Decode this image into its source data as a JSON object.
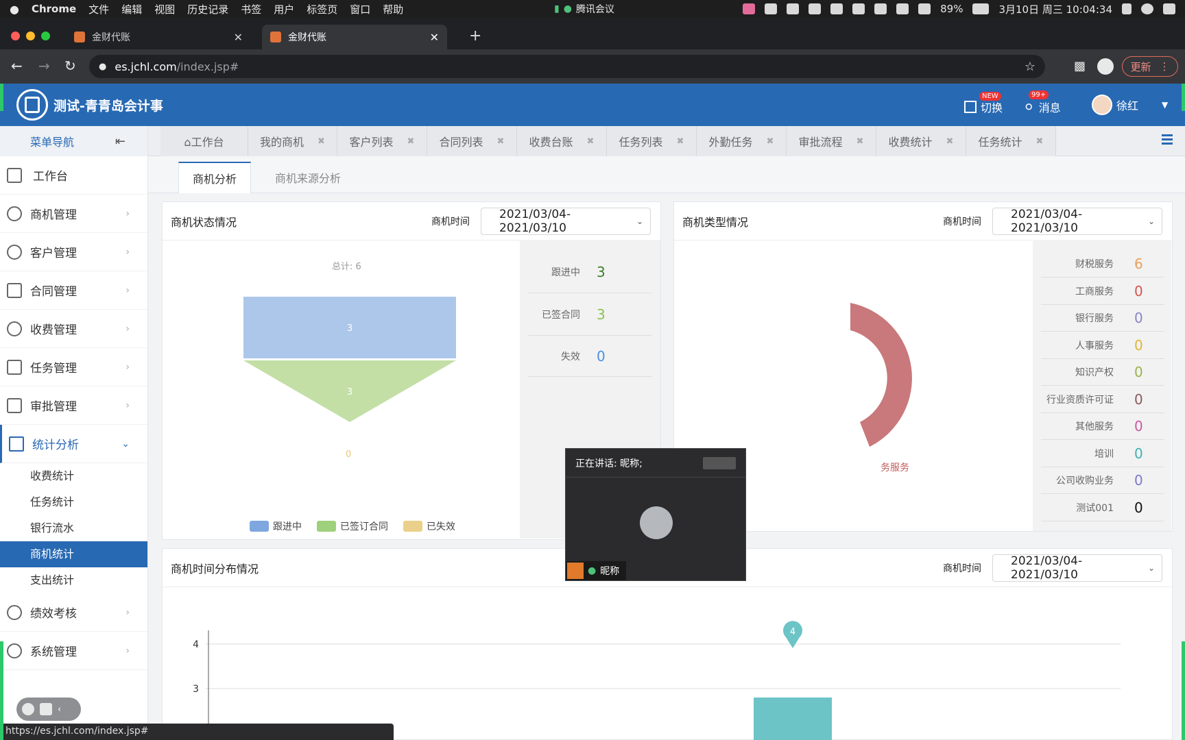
{
  "mac_menubar": {
    "apple_icon": "apple-icon",
    "app": "Chrome",
    "items": [
      "文件",
      "编辑",
      "视图",
      "历史记录",
      "书签",
      "用户",
      "标签页",
      "窗口",
      "帮助"
    ],
    "meeting": "腾讯会议",
    "battery": "89%",
    "datetime": "3月10日 周三  10:04:34"
  },
  "browser": {
    "tabs": [
      {
        "title": "金财代账",
        "active": false
      },
      {
        "title": "金财代账",
        "active": true
      }
    ],
    "url_host": "es.jchl.com",
    "url_path": "/index.jsp#",
    "update_label": "更新",
    "status_url": "https://es.jchl.com/index.jsp#"
  },
  "header": {
    "title": "测试-青青岛会计事",
    "switch_label": "切换",
    "switch_badge": "NEW",
    "msg_label": "消息",
    "msg_badge": "99+",
    "user_name": "徐红"
  },
  "sidebar": {
    "head_label": "菜单导航",
    "items": [
      {
        "label": "工作台",
        "icon": "home-icon"
      },
      {
        "label": "商机管理",
        "icon": "dollar-icon"
      },
      {
        "label": "客户管理",
        "icon": "user-icon"
      },
      {
        "label": "合同管理",
        "icon": "contract-icon"
      },
      {
        "label": "收费管理",
        "icon": "yen-icon"
      },
      {
        "label": "任务管理",
        "icon": "task-icon"
      },
      {
        "label": "审批管理",
        "icon": "approval-icon"
      },
      {
        "label": "统计分析",
        "icon": "chart-icon"
      }
    ],
    "sub_items": [
      "收费统计",
      "任务统计",
      "银行流水",
      "商机统计",
      "支出统计"
    ],
    "items_after": [
      {
        "label": "绩效考核",
        "icon": "performance-icon"
      },
      {
        "label": "系统管理",
        "icon": "gear-icon"
      }
    ]
  },
  "page_tabs": [
    "工作台",
    "我的商机",
    "客户列表",
    "合同列表",
    "收费台账",
    "任务列表",
    "外勤任务",
    "审批流程",
    "收费统计",
    "任务统计"
  ],
  "sub_tabs": [
    "商机分析",
    "商机来源分析"
  ],
  "status_panel": {
    "title": "商机状态情况",
    "date_label": "商机时间",
    "date_value": "2021/03/04-2021/03/10",
    "total_label": "总计: 6",
    "funnel_values": [
      "3",
      "3",
      "0"
    ],
    "stats": [
      {
        "label": "跟进中",
        "value": "3",
        "color": "#3f7f2b"
      },
      {
        "label": "已签合同",
        "value": "3",
        "color": "#8cc152"
      },
      {
        "label": "失效",
        "value": "0",
        "color": "#4a90e2"
      }
    ],
    "legend": [
      {
        "label": "跟进中",
        "color": "#7fa7df"
      },
      {
        "label": "已签订合同",
        "color": "#9fd07c"
      },
      {
        "label": "已失效",
        "color": "#ead08a"
      }
    ]
  },
  "type_panel": {
    "title": "商机类型情况",
    "date_label": "商机时间",
    "date_value": "2021/03/04-2021/03/10",
    "pie_label": "务服务",
    "stats": [
      {
        "label": "财税服务",
        "value": "6",
        "color": "#e8a05c"
      },
      {
        "label": "工商服务",
        "value": "0",
        "color": "#d9534f"
      },
      {
        "label": "银行服务",
        "value": "0",
        "color": "#8a84c9"
      },
      {
        "label": "人事服务",
        "value": "0",
        "color": "#e0b63a"
      },
      {
        "label": "知识产权",
        "value": "0",
        "color": "#9ab34a"
      },
      {
        "label": "行业资质许可证",
        "value": "0",
        "color": "#8a5a5a"
      },
      {
        "label": "其他服务",
        "value": "0",
        "color": "#c75aa0"
      },
      {
        "label": "培训",
        "value": "0",
        "color": "#3fb3b0"
      },
      {
        "label": "公司收购业务",
        "value": "0",
        "color": "#7a7ad0"
      },
      {
        "label": "测试001",
        "value": "0",
        "color": "#111111"
      }
    ]
  },
  "time_panel": {
    "title": "商机时间分布情况",
    "date_label": "商机时间",
    "date_value": "2021/03/04-2021/03/10"
  },
  "video": {
    "speaking": "正在讲话: 昵称;",
    "name": "昵称"
  },
  "chart_data": {
    "type": "bar",
    "title": "商机时间分布情况",
    "xlabel": "",
    "ylabel": "",
    "y_ticks": [
      3,
      4
    ],
    "ylim": [
      0,
      4
    ],
    "bars": [
      {
        "value": 4,
        "marker_label": "4"
      }
    ],
    "color": "#6cc4c6",
    "grid": true
  }
}
